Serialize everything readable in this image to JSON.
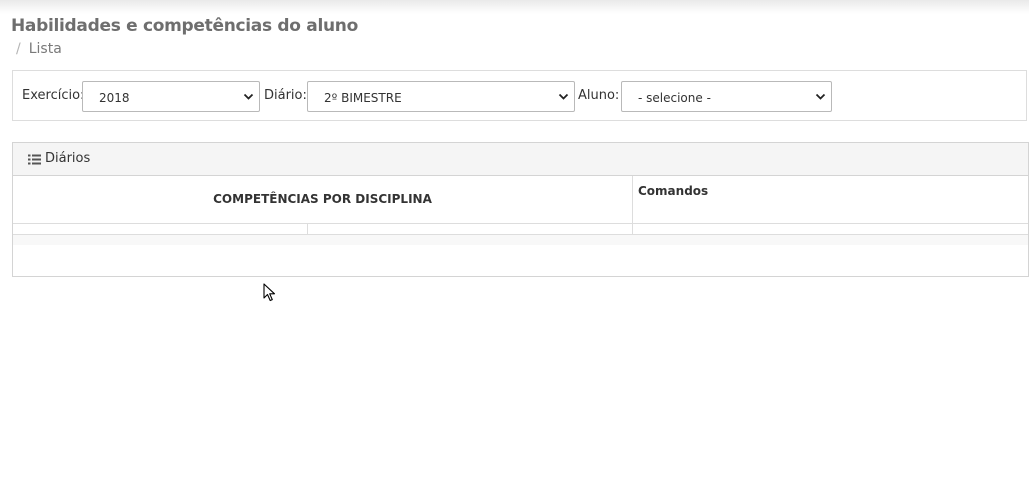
{
  "page": {
    "title": "Habilidades e competências do aluno",
    "breadcrumb": {
      "separator": "/",
      "current": "Lista"
    }
  },
  "filters": {
    "exercicio": {
      "label": "Exercício:",
      "value": "2018"
    },
    "diario": {
      "label": "Diário:",
      "value": "2º BIMESTRE"
    },
    "aluno": {
      "label": "Aluno:",
      "value": "- selecione -"
    }
  },
  "panel": {
    "title": "Diários",
    "icon": "list-icon",
    "columns": [
      "COMPETÊNCIAS POR DISCIPLINA",
      "Comandos"
    ]
  },
  "colors": {
    "title": "#6e6e6e",
    "panel_header_bg": "#f5f5f5",
    "border": "#dddddd"
  }
}
